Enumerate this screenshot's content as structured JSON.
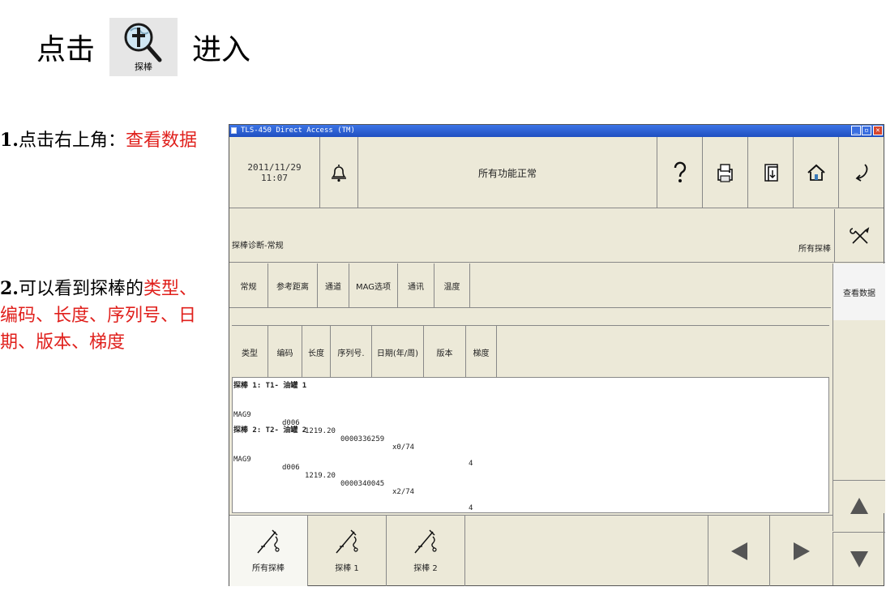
{
  "intro": {
    "before": "点击",
    "after": "进入",
    "icon_caption": "探棒",
    "icon": "probe-magnifier-icon"
  },
  "step1": {
    "num": "1.",
    "text": "点击右上角：",
    "highlight": "查看数据"
  },
  "step2": {
    "num": "2.",
    "text": "可以看到探棒的",
    "highlight": "类型、编码、长度、序列号、日期、版本、梯度"
  },
  "window": {
    "title": "TLS-450 Direct Access (TM)",
    "date": "2011/11/29",
    "time": "11:07",
    "status": "所有功能正常",
    "breadcrumb": "探棒诊断-常规",
    "filter_label": "所有探棒",
    "view_data": "查看数据"
  },
  "tabs_top": [
    "常规",
    "参考距离",
    "通道",
    "MAG选项",
    "通讯",
    "温度"
  ],
  "tabs_data": [
    "类型",
    "编码",
    "长度",
    "序列号.",
    "日期(年/周)",
    "版本",
    "梯度"
  ],
  "groups": [
    {
      "title": "探棒 1: T1- 油罐 1",
      "row": {
        "type": "MAG9",
        "code": "d006",
        "length": "1219.20",
        "serial": "0000336259",
        "date": "x0/74",
        "version": "",
        "gradient": "4"
      }
    },
    {
      "title": "探棒 2: T2- 油罐 2",
      "row": {
        "type": "MAG9",
        "code": "d006",
        "length": "1219.20",
        "serial": "0000340045",
        "date": "x2/74",
        "version": "",
        "gradient": "4"
      }
    }
  ],
  "bottom_tabs": [
    "所有探棒",
    "探棒 1",
    "探棒 2"
  ],
  "icons": {
    "bell": "bell-icon",
    "help": "question-icon",
    "printer": "printer-icon",
    "report": "report-icon",
    "home": "home-icon",
    "back": "back-arrow-icon",
    "tools": "tools-icon",
    "probe": "probe-icon"
  },
  "colors": {
    "accent_red": "#e0201c",
    "title_blue": "#1f4fc0",
    "panel": "#ece9d8"
  }
}
